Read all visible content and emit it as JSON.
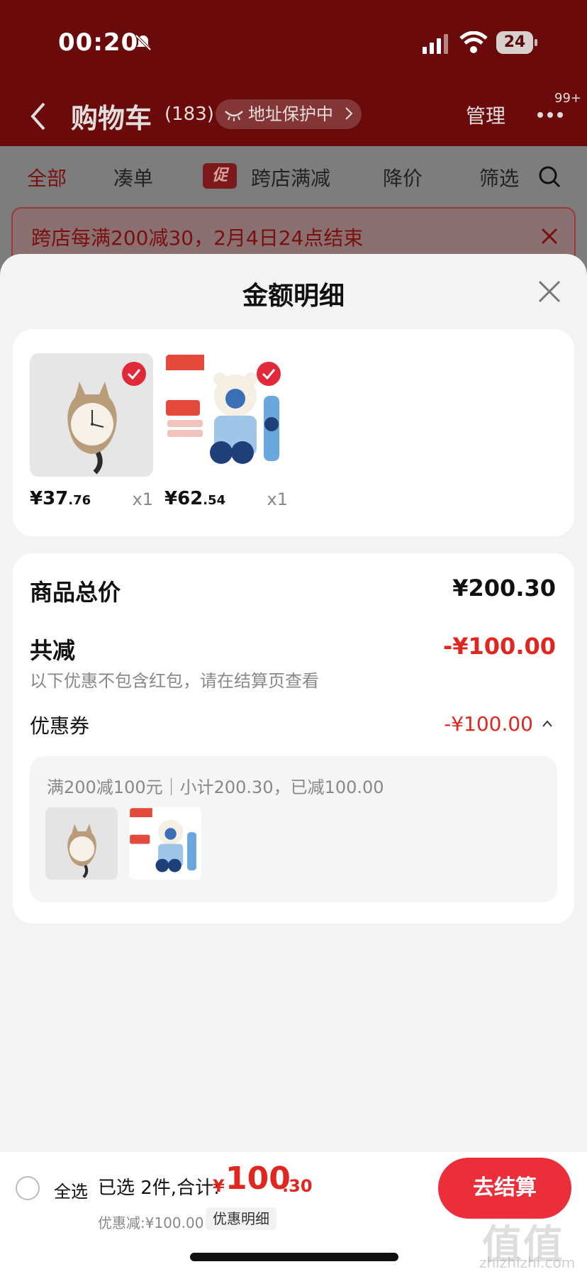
{
  "status": {
    "time": "00:20",
    "battery": "24"
  },
  "nav": {
    "title": "购物车",
    "count": "(183)",
    "address": "地址保护中",
    "manage": "管理",
    "badge": "99+"
  },
  "tabs": [
    {
      "label": "全部",
      "active": true
    },
    {
      "label": "凑单"
    },
    {
      "label": "跨店满减",
      "tag": "促"
    },
    {
      "label": "降价"
    },
    {
      "label": "筛选"
    }
  ],
  "promo": {
    "text": "跨店每满200减30，2月4日24点结束"
  },
  "sheet": {
    "title": "金额明细",
    "items": [
      {
        "price_int": "¥37",
        "price_dec": ".76",
        "qty": "x1"
      },
      {
        "price_int": "¥62",
        "price_dec": ".54",
        "qty": "x1"
      }
    ],
    "goods_total_label": "商品总价",
    "goods_total_value": "¥200.30",
    "reduce_label": "共减",
    "reduce_value": "-¥100.00",
    "note": "以下优惠不包含红包，请在结算页查看",
    "coupon_label": "优惠券",
    "coupon_value": "-¥100.00",
    "coupon_desc": "满200减100元｜小计200.30，已减100.00"
  },
  "bottom": {
    "select_all": "全选",
    "selected_text": "已选 2件,合计:",
    "total_symbol": "¥",
    "total_int": "100",
    "total_dec": ".30",
    "discount_text": "优惠减:¥100.00",
    "detail_label": "优惠明细",
    "checkout_label": "去结算"
  },
  "watermark": {
    "main": "值值值",
    "sub": "zhizhizhi.com"
  },
  "colors": {
    "accent": "#e0261f",
    "checkout": "#ec2d3a",
    "dim_red": "#6a0a0a"
  }
}
